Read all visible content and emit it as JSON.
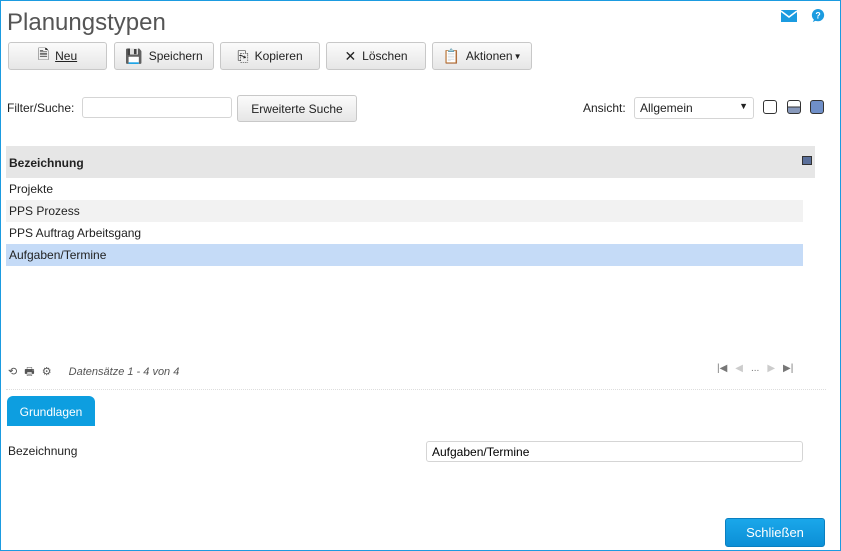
{
  "title": "Planungstypen",
  "toolbar": {
    "new": "Neu",
    "save": "Speichern",
    "copy": "Kopieren",
    "delete": "Löschen",
    "actions": "Aktionen"
  },
  "filter": {
    "label": "Filter/Suche:",
    "value": "",
    "advanced": "Erweiterte Suche"
  },
  "view": {
    "label": "Ansicht:",
    "selected": "Allgemein"
  },
  "grid": {
    "header": "Bezeichnung",
    "rows": [
      "Projekte",
      "PPS Prozess",
      "PPS Auftrag Arbeitsgang",
      "Aufgaben/Termine"
    ]
  },
  "footer": {
    "records": "Datensätze 1 - 4 von 4",
    "ellipsis": "..."
  },
  "tabs": {
    "active": "Grundlagen"
  },
  "form": {
    "label": "Bezeichnung",
    "value": "Aufgaben/Termine"
  },
  "close": "Schließen"
}
